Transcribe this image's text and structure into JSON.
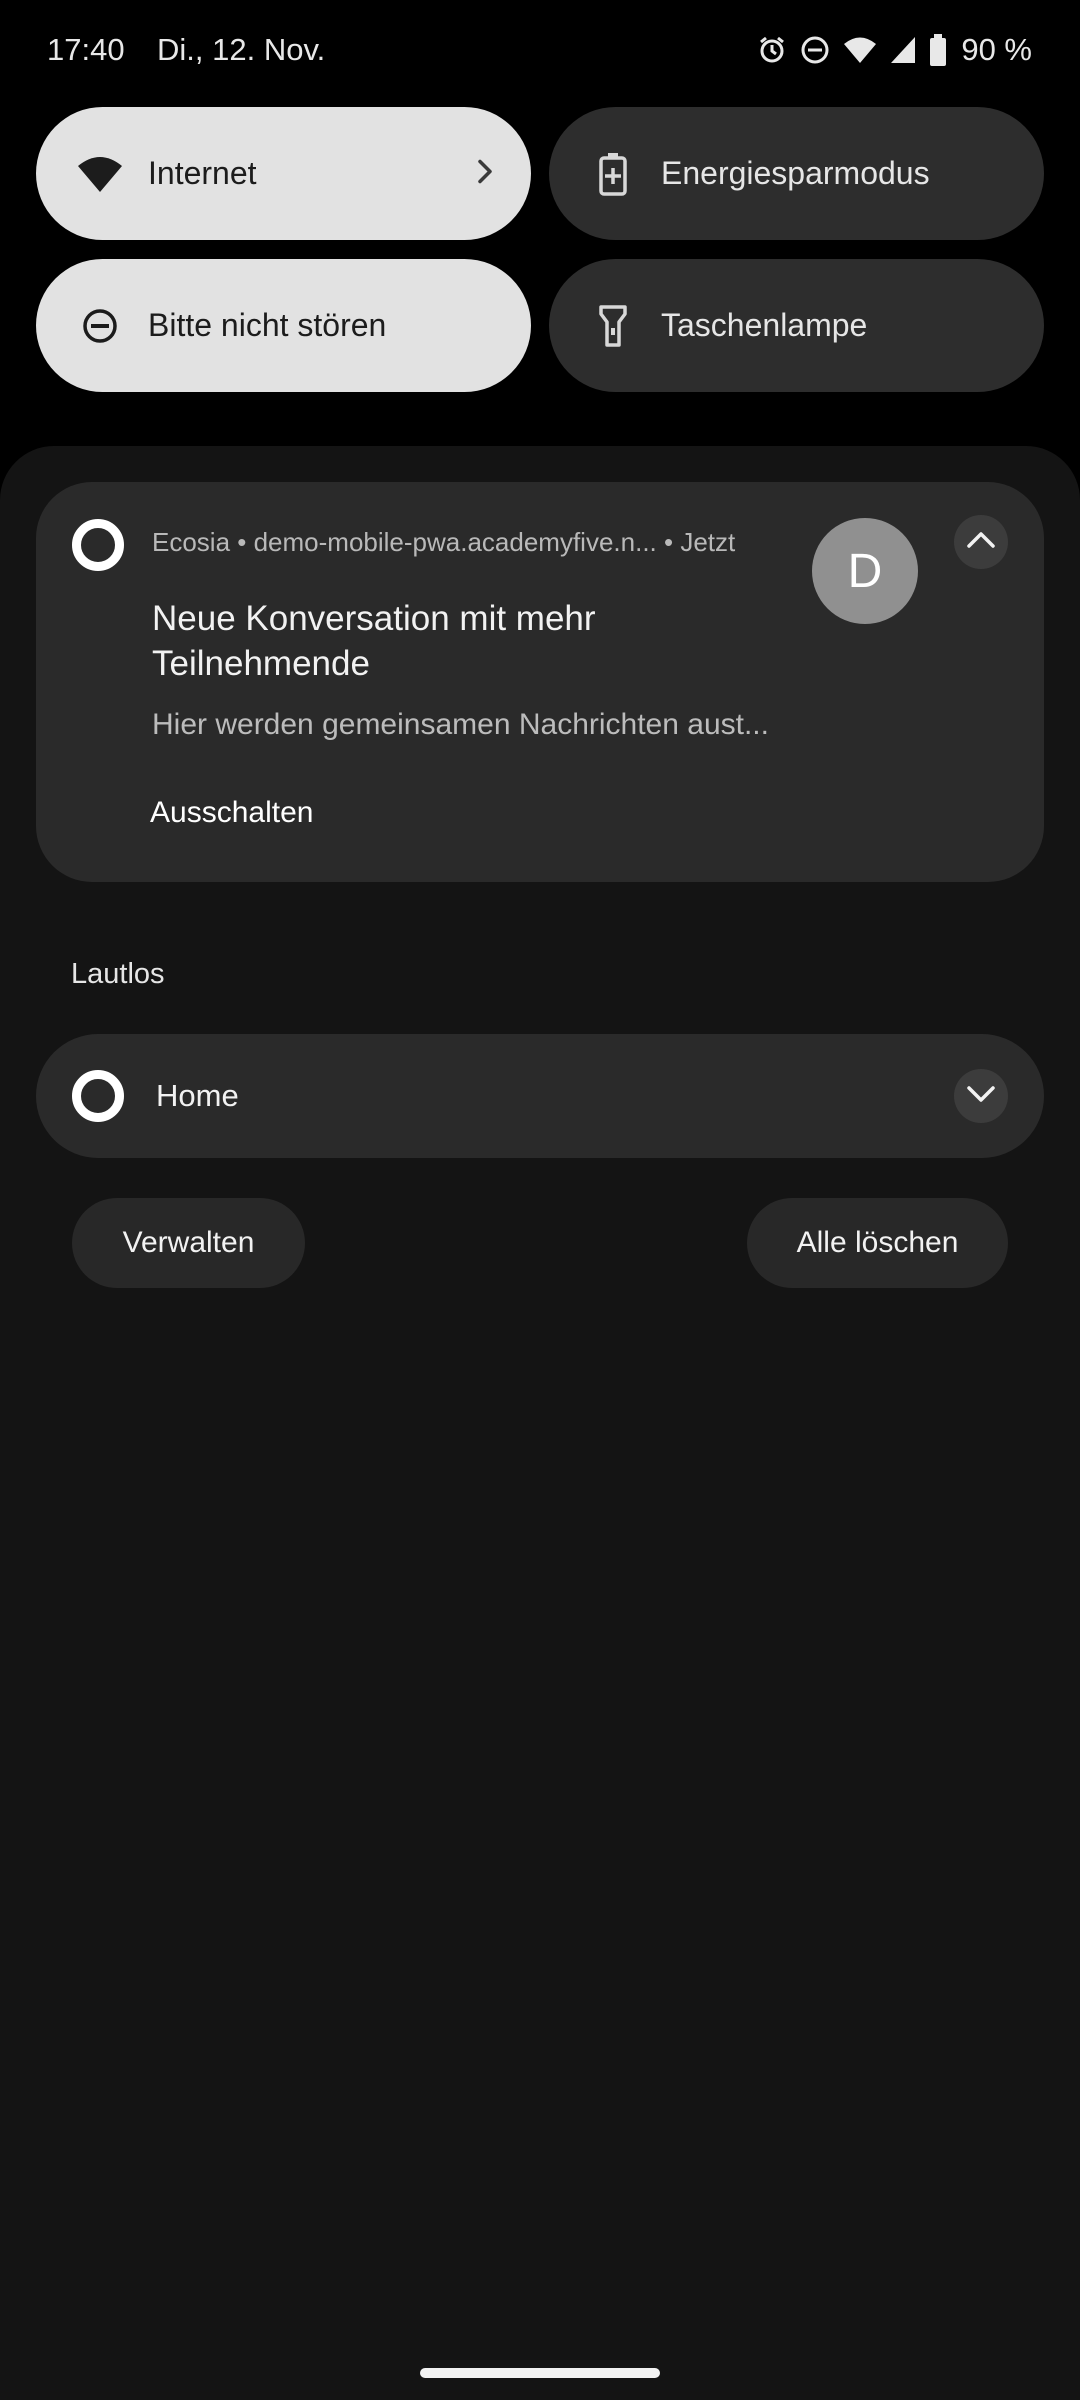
{
  "status_bar": {
    "time": "17:40",
    "date": "Di., 12. Nov.",
    "icons": [
      "alarm-icon",
      "dnd-icon",
      "wifi-icon",
      "signal-icon",
      "battery-icon"
    ],
    "battery": "90 %"
  },
  "quick_settings": {
    "tiles": [
      {
        "label": "Internet",
        "icon": "wifi-icon",
        "active": true
      },
      {
        "label": "Energiesparmodus",
        "icon": "battery-saver-icon",
        "active": false
      },
      {
        "label": "Bitte nicht stören",
        "icon": "dnd-icon",
        "active": true
      },
      {
        "label": "Taschenlampe",
        "icon": "flashlight-icon",
        "active": false
      }
    ]
  },
  "notification": {
    "app": "Ecosia",
    "source": "demo-mobile-pwa.academyfive.n...",
    "time": "Jetzt",
    "meta": "Ecosia • demo-mobile-pwa.academyfive.n... • Jetzt",
    "title": "Neue Konversation mit mehr Teilnehmende",
    "body": "Hier werden gemeinsamen Nachrichten aust...",
    "action": "Ausschalten",
    "avatar_letter": "D"
  },
  "silent": {
    "section_label": "Lautlos",
    "item_label": "Home"
  },
  "footer": {
    "manage": "Verwalten",
    "clear_all": "Alle löschen"
  },
  "colors": {
    "background": "#000000",
    "panel": "#141414",
    "card": "#2a2a2a",
    "tile_on": "#e2e2e2",
    "tile_off": "#2d2d2d",
    "avatar": "#909090"
  }
}
